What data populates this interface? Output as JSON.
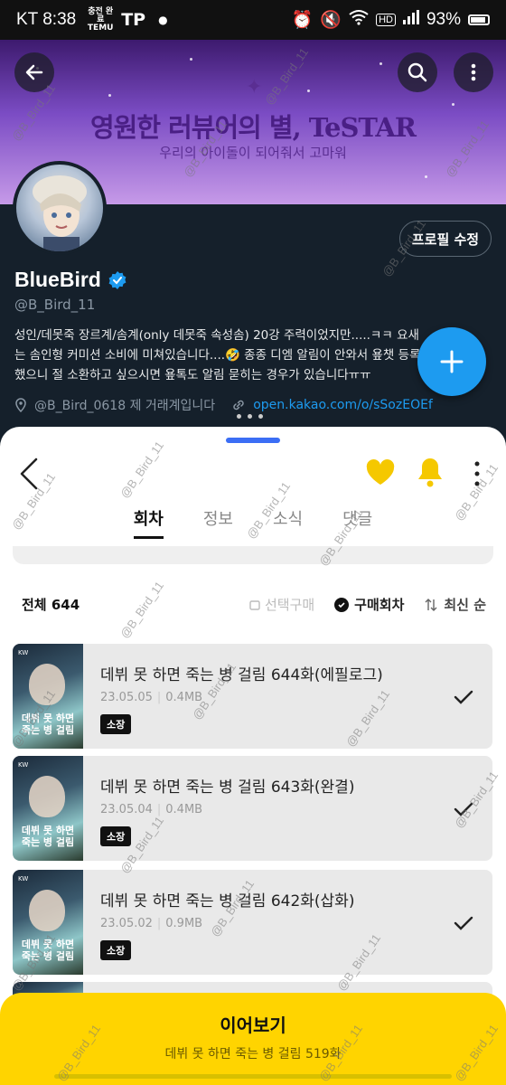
{
  "status_bar": {
    "carrier": "KT",
    "time": "8:38",
    "temu_label": "충전 완료 TEMU",
    "tp_label": "TP",
    "battery": "93%",
    "hd": "HD"
  },
  "banner": {
    "title": "영원한 러뷰어의 별, TeSTAR",
    "subtitle": "우리의 아이돌이 되어줘서 고마워"
  },
  "profile": {
    "edit_label": "프로필 수정",
    "name": "BlueBird",
    "handle": "@B_Bird_11",
    "bio": "성인/데못죽 장르계/솜계(only 데못죽 속성솜) 20강 주력이었지만.....ㅋㅋ 요새는 솜인형 커미션 소비에 미쳐있습니다....🤣 종종 디엠 알림이 안와서 욮챗 등록했으니 절 소환하고 싶으시면 욮톡도 알림 묻히는 경우가 있습니다ㅠㅠ",
    "location": "@B_Bird_0618 제 거래계입니다",
    "link": "open.kakao.com/o/sSozEOEf"
  },
  "sheet": {
    "tabs": [
      {
        "label": "회차",
        "active": true
      },
      {
        "label": "정보",
        "active": false
      },
      {
        "label": "소식",
        "active": false
      },
      {
        "label": "댓글",
        "active": false
      }
    ],
    "total_label": "전체 644",
    "select_buy": "선택구매",
    "purchased": "구매회차",
    "sort": "최신 순",
    "episodes": [
      {
        "title": "데뷔 못 하면 죽는 병 걸림 644화(에필로그)",
        "date": "23.05.05",
        "size": "0.4MB",
        "badge": "소장",
        "thumb_title": "데뷔 못 하면 죽는 병 걸림"
      },
      {
        "title": "데뷔 못 하면 죽는 병 걸림 643화(완결)",
        "date": "23.05.04",
        "size": "0.4MB",
        "badge": "소장",
        "thumb_title": "데뷔 못 하면 죽는 병 걸림"
      },
      {
        "title": "데뷔 못 하면 죽는 병 걸림 642화(삽화)",
        "date": "23.05.02",
        "size": "0.9MB",
        "badge": "소장",
        "thumb_title": "데뷔 못 하면 죽는 병 걸림"
      }
    ],
    "continue_label": "이어보기",
    "continue_sub": "데뷔 못 하면 죽는 병 걸림 519화"
  },
  "watermark": "@B_Bird_11",
  "colors": {
    "accent_blue": "#1d9bf0",
    "kakao_yellow": "#ffd400",
    "dark_bg": "#15202b"
  }
}
